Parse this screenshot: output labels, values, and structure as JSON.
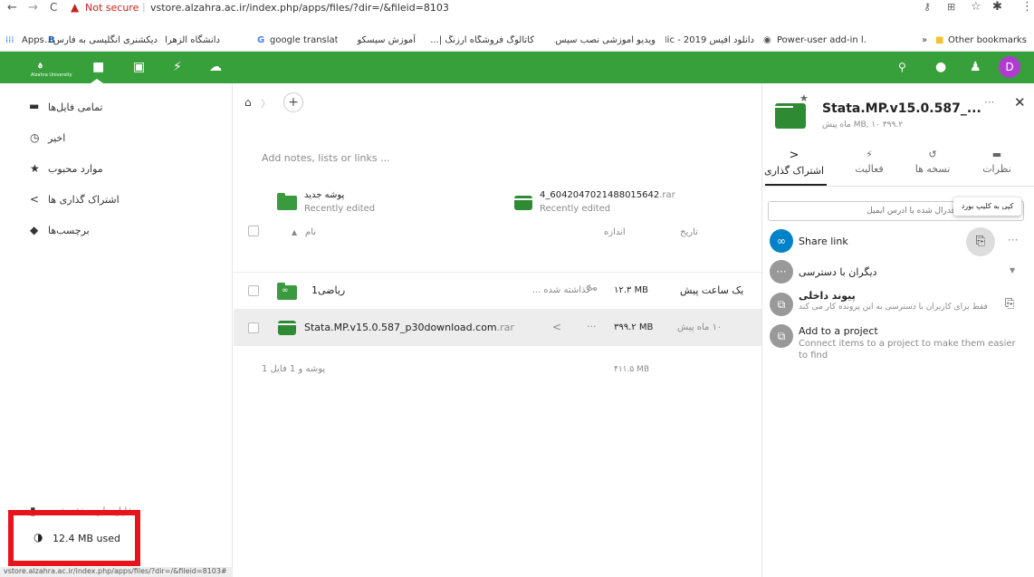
{
  "browser": {
    "nav_back": "←",
    "nav_forward": "→",
    "reload": "C",
    "security_label": "Not secure",
    "url": "vstore.alzahra.ac.ir/index.php/apps/files/?dir=/&fileid=8103",
    "bookmarks": [
      {
        "label": "Apps"
      },
      {
        "label": "دیکشنری انگلیسی به فارس..."
      },
      {
        "label": "دانشگاه الزهرا"
      },
      {
        "label": "google translate -..."
      },
      {
        "label": "آموزش سیسکو"
      },
      {
        "label": "کاتالوگ فروشگاه ارزنگ |..."
      },
      {
        "label": "ویدیو آموزشی نصب سیس..."
      },
      {
        "label": "دانلود آفیس 2019 - Mic..."
      },
      {
        "label": "Power-user add-in l..."
      }
    ],
    "bookmarks_overflow": "»",
    "other_bookmarks": "Other bookmarks"
  },
  "header": {
    "logo_text": "Alzahra University",
    "brand_color": "#37a03a",
    "user_initial": "D",
    "user_color": "#b03ccf"
  },
  "navigation": {
    "items": [
      {
        "label": "تمامی فایل‌ها",
        "icon": "folder-icon"
      },
      {
        "label": "اخیر",
        "icon": "clock-icon"
      },
      {
        "label": "موارد محبوب",
        "icon": "star-icon"
      },
      {
        "label": "اشتراک گذاری ها",
        "icon": "share-icon"
      },
      {
        "label": "برچسب‌ها",
        "icon": "tag-icon"
      }
    ],
    "deleted_files": "فایل های حذف شده",
    "quota": "12.4 MB used",
    "status_url": "vstore.alzahra.ac.ir/index.php/apps/files/?dir=/&fileid=8103#"
  },
  "files": {
    "notes_placeholder": "Add notes, lists or links ...",
    "recent": [
      {
        "name": "پوشه جدید",
        "sub": "Recently edited",
        "type": "folder"
      },
      {
        "name": "4_6042047021488015642",
        "ext": ".rar",
        "sub": "Recently edited",
        "type": "archive"
      }
    ],
    "columns": {
      "name": "نام",
      "size": "اندازه",
      "modified": "تاریخ"
    },
    "rows": [
      {
        "name": "ریاضی1",
        "shared_label": "گذاشته شده ...",
        "size": "۱۲.۳ MB",
        "modified": "یک ساعت پیش",
        "type": "folder"
      },
      {
        "name": "Stata.MP.v15.0.587_p30download.com",
        "ext": ".rar",
        "size": "۳۹۹.۲ MB",
        "modified": "۱۰ ماه پیش",
        "type": "archive"
      }
    ],
    "summary": "پوشه و 1 فایل 1",
    "summary_size": "۴۱۱.۵ MB"
  },
  "sidebar": {
    "title": "Stata.MP.v15.0.587_...",
    "subtitle": "۳۹۹.۲ MB, ۱۰ ماه پیش",
    "tabs": [
      {
        "label": "اشتراک گذاری",
        "icon": "share-icon"
      },
      {
        "label": "فعالیت",
        "icon": "flash-icon"
      },
      {
        "label": "نسخه ها",
        "icon": "history-icon"
      },
      {
        "label": "نظرات",
        "icon": "comment-icon"
      }
    ],
    "share_input_placeholder": "...نام ، شناسه ابر فدرال شده یا آدرس ایمیل",
    "tooltip": "کپی به کلیپ بورد",
    "share_link": "Share link",
    "others_access": "دیگران با دسترسی",
    "internal_link_title": "پیوند داخلی",
    "internal_link_desc": "فقط برای کاربران با دسترسی به این پرونده کار می کند",
    "project_title": "Add to a project",
    "project_desc": "Connect items to a project to make them easier to find"
  }
}
